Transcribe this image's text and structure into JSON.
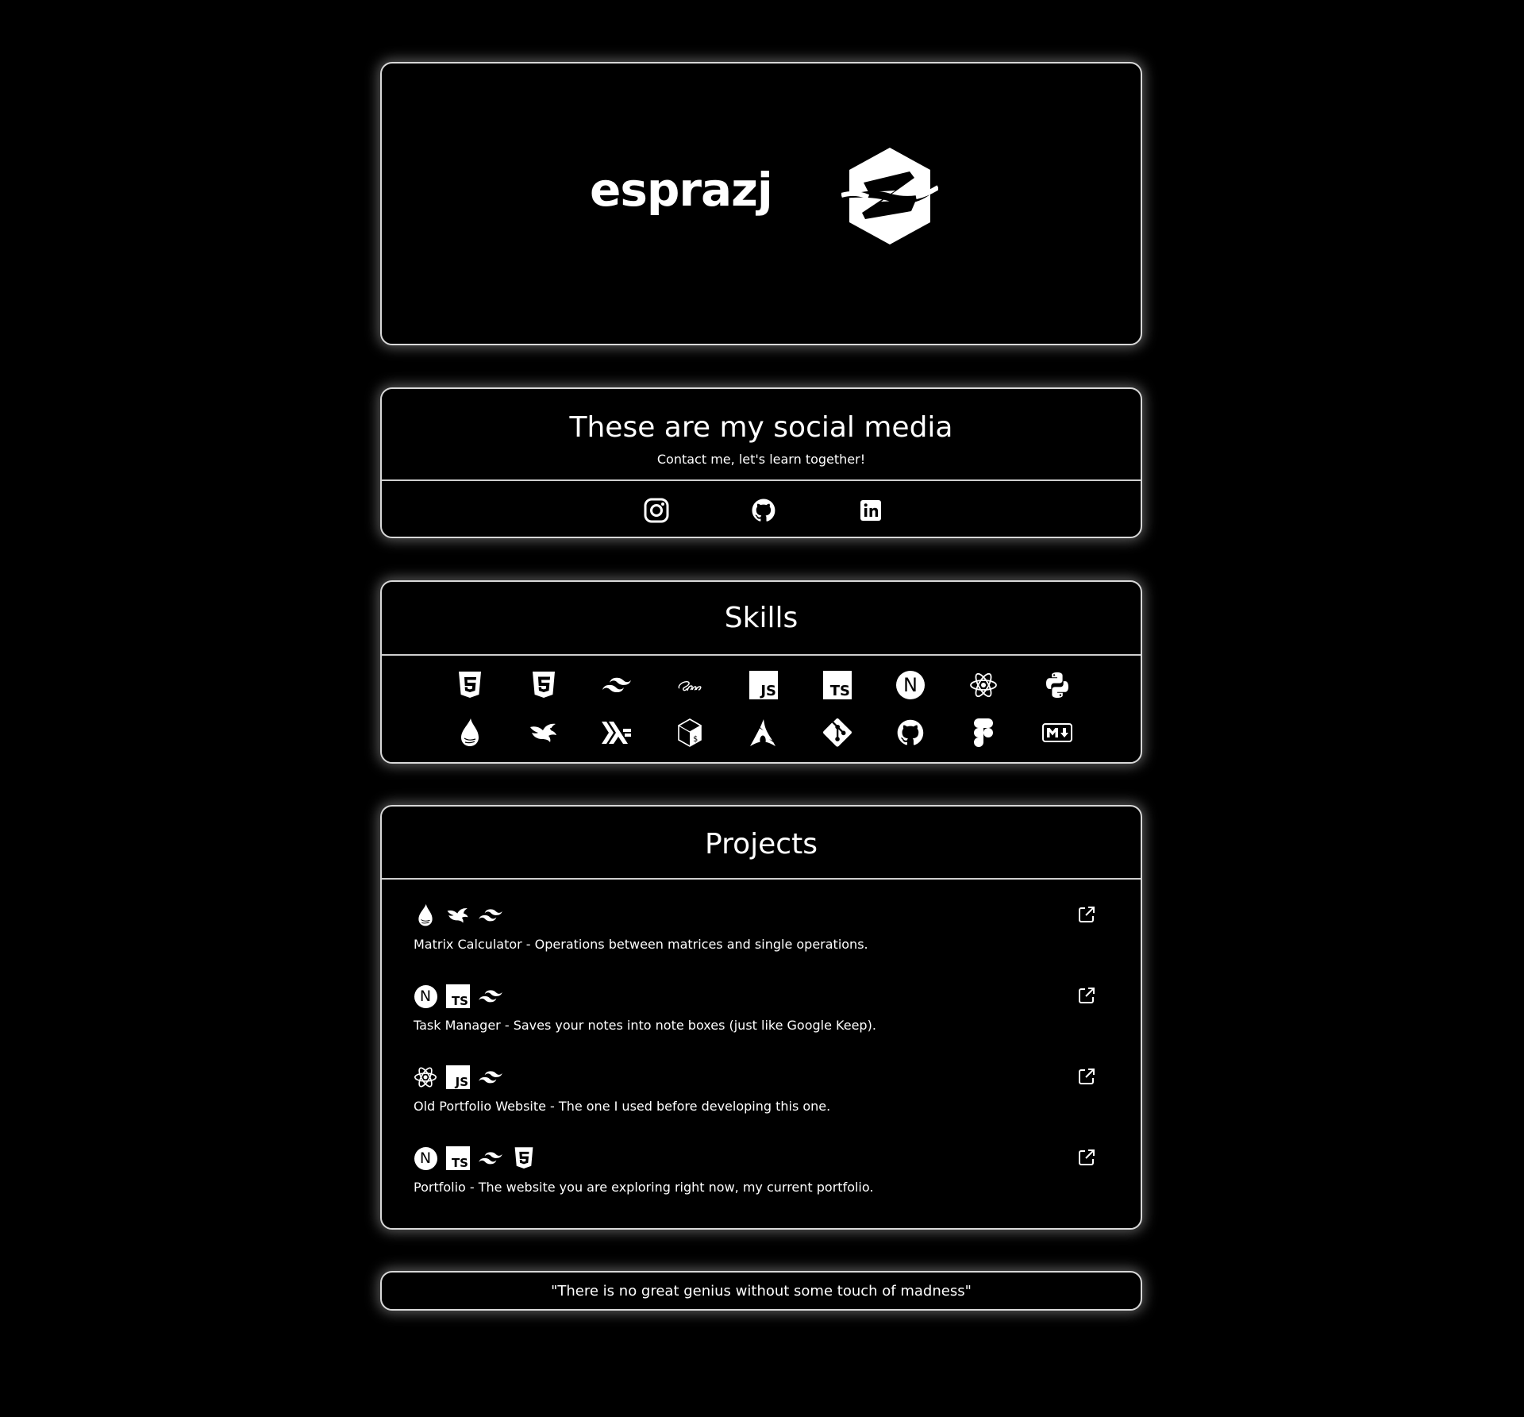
{
  "hero": {
    "name": "esprazj",
    "logo_icon": "ez-monogram-logo"
  },
  "social": {
    "title": "These are my social media",
    "subtitle": "Contact me, let's learn together!",
    "links": [
      {
        "icon": "instagram-icon"
      },
      {
        "icon": "github-icon"
      },
      {
        "icon": "linkedin-icon"
      }
    ]
  },
  "skills": {
    "title": "Skills",
    "row1": [
      "html5-icon",
      "css3-icon",
      "tailwind-icon",
      "sass-icon",
      "javascript-icon",
      "typescript-icon",
      "nextjs-icon",
      "react-icon",
      "python-icon"
    ],
    "row2": [
      "drop-icon",
      "bird-icon",
      "haskell-icon",
      "bash-icon",
      "arch-linux-icon",
      "git-icon",
      "github-icon",
      "figma-icon",
      "markdown-icon"
    ],
    "badges": {
      "js": "JS",
      "ts": "TS",
      "next": "N"
    }
  },
  "projects": {
    "title": "Projects",
    "items": [
      {
        "icons": [
          "drop-icon",
          "bird-icon",
          "tailwind-icon"
        ],
        "description": "Matrix Calculator - Operations between matrices and single operations."
      },
      {
        "icons": [
          "nextjs-icon",
          "typescript-icon",
          "tailwind-icon"
        ],
        "description": "Task Manager - Saves your notes into note boxes (just like Google Keep)."
      },
      {
        "icons": [
          "react-icon",
          "javascript-icon",
          "tailwind-icon"
        ],
        "description": "Old Portfolio Website - The one I used before developing this one."
      },
      {
        "icons": [
          "nextjs-icon",
          "typescript-icon",
          "tailwind-icon",
          "css3-icon"
        ],
        "description": "Portfolio - The website you are exploring right now, my current portfolio."
      }
    ],
    "link_icon": "external-link-icon"
  },
  "quote": {
    "text": "\"There is no great genius without some touch of madness\""
  },
  "colors": {
    "background": "#000000",
    "foreground": "#ffffff",
    "border": "#d8d8d8"
  }
}
